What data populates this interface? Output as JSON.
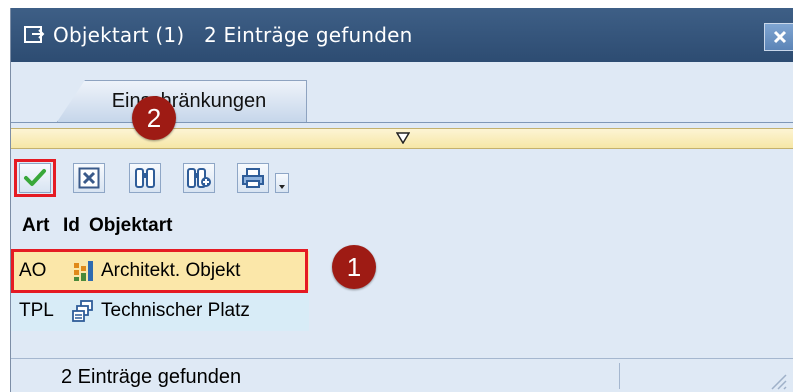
{
  "window": {
    "title": "Objektart (1)   2 Einträge gefunden",
    "close_label": "×"
  },
  "tabs": [
    {
      "label": "Einschränkungen",
      "active": true
    }
  ],
  "toolbar": {
    "buttons": [
      {
        "name": "confirm-button",
        "icon": "checkmark-icon"
      },
      {
        "name": "cancel-button",
        "icon": "cancel-x-icon"
      },
      {
        "name": "find-button",
        "icon": "binoculars-icon"
      },
      {
        "name": "find-next-button",
        "icon": "binoculars-plus-icon"
      },
      {
        "name": "print-button",
        "icon": "printer-icon"
      }
    ]
  },
  "table": {
    "columns": [
      "Art",
      "Id",
      "Objektart"
    ],
    "rows": [
      {
        "art": "AO",
        "icon": "architectural-object-icon",
        "objektart": "Architekt. Objekt",
        "highlighted": true
      },
      {
        "art": "TPL",
        "icon": "technical-place-icon",
        "objektart": "Technischer Platz",
        "highlighted": false
      }
    ]
  },
  "annotations": [
    {
      "label": "1"
    },
    {
      "label": "2"
    }
  ],
  "status": {
    "text": "2 Einträge gefunden"
  },
  "colors": {
    "titlebar": "#2f4f78",
    "highlight_row": "#fbe7a9",
    "annotation_red": "#e51b23",
    "badge": "#9e1b14"
  }
}
